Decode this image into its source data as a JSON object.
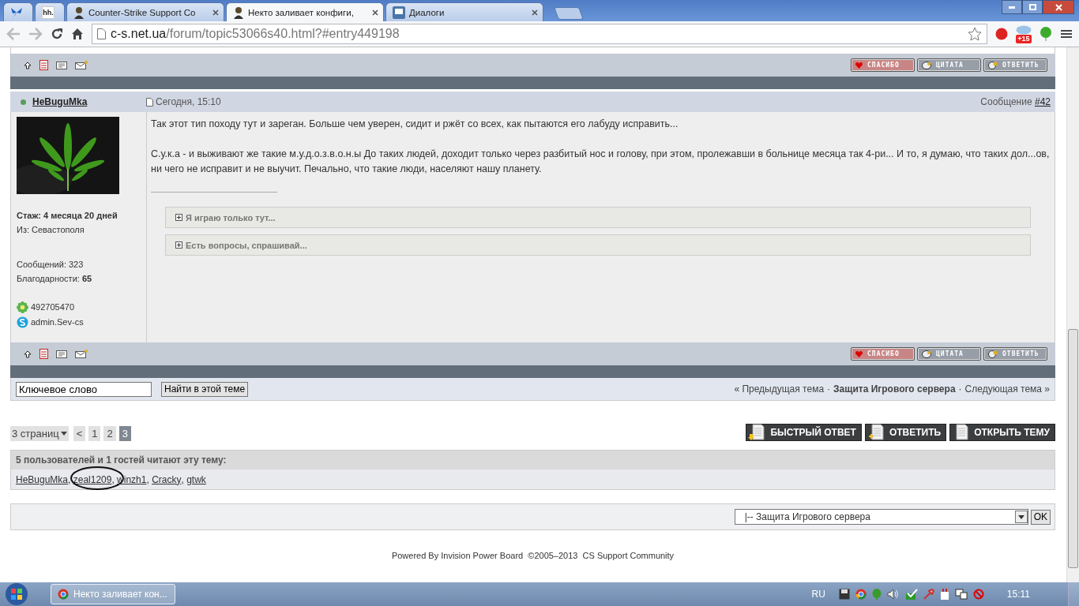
{
  "browser": {
    "tabs": [
      {
        "kind": "butterfly",
        "selected": false
      },
      {
        "kind": "hh",
        "icon_text": "hh.",
        "selected": false
      },
      {
        "kind": "person",
        "title": "Counter-Strike Support Co",
        "selected": false
      },
      {
        "kind": "person",
        "title": "Некто заливает конфиги,",
        "selected": true
      },
      {
        "kind": "chat",
        "title": "Диалоги",
        "selected": false
      }
    ],
    "address": {
      "host": "c-s.net.ua",
      "path": "/forum/topic53066s40.html?#entry449198"
    },
    "extension_badge": "+15"
  },
  "post": {
    "author": "HeBuguMka",
    "online": true,
    "date": "Сегодня, 15:10",
    "number_label": "Сообщение",
    "number": "#42",
    "paragraphs": [
      "Так этот тип походу тут и зареган. Больше чем уверен, сидит и ржёт со всех, как пытаются его лабуду исправить...",
      "С.у.к.а - и выживают же такие м.у.д.о.з.в.о.н.ы До таких людей, доходит только через разбитый нос и голову, при этом, пролежавши в больнице месяца так 4-ри... И то, я думаю, что таких дол...ов, ни чего не исправит и не выучит. Печально, что такие люди, населяют нашу планету."
    ],
    "spoilers": [
      {
        "label": "Я играю только тут...",
        "expanded": false
      },
      {
        "label": "Есть вопросы, спрашивай...",
        "expanded": false
      }
    ],
    "profile": {
      "stat_groups": [
        [
          {
            "text": "Стаж: 4 месяца 20 дней",
            "bold": true
          },
          {
            "text": "Из: Севастополя",
            "bold": false
          }
        ],
        [
          {
            "text": "Сообщений: 323",
            "bold": false
          },
          {
            "text": "Благодарности: **65**",
            "bold": false
          }
        ]
      ],
      "contacts": [
        {
          "kind": "icq",
          "text": "492705470"
        },
        {
          "kind": "skype",
          "text": "admin.Sev-cs"
        }
      ]
    }
  },
  "action_bars": [
    {
      "buttons": [
        {
          "kind": "thanks",
          "label": "СПАСИБО"
        },
        {
          "kind": "quote",
          "label": "ЦИТАТА"
        },
        {
          "kind": "reply",
          "label": "ОТВЕТИТЬ"
        }
      ]
    },
    {
      "buttons": [
        {
          "kind": "thanks",
          "label": "СПАСИБО"
        },
        {
          "kind": "quote",
          "label": "ЦИТАТА"
        },
        {
          "kind": "reply",
          "label": "ОТВЕТИТЬ"
        }
      ]
    }
  ],
  "topic_search": {
    "value": "Ключевое слово",
    "button": "Найти в этой теме"
  },
  "topic_nav": [
    {
      "kind": "link",
      "text": "« Предыдущая тема"
    },
    {
      "kind": "sep",
      "text": "·"
    },
    {
      "kind": "current",
      "text": "Защита Игрового сервера"
    },
    {
      "kind": "sep",
      "text": "·"
    },
    {
      "kind": "link",
      "text": "Следующая тема »"
    }
  ],
  "pagination": {
    "pages_menu": "3 страниц",
    "prev": "<",
    "pages": [
      {
        "label": "1",
        "selected": false
      },
      {
        "label": "2",
        "selected": false
      },
      {
        "label": "3",
        "selected": true
      }
    ]
  },
  "topic_buttons": [
    {
      "kind": "down",
      "label": "БЫСТРЫЙ ОТВЕТ"
    },
    {
      "kind": "plus",
      "label": "ОТВЕТИТЬ"
    },
    {
      "kind": "doc",
      "label": "ОТКРЫТЬ ТЕМУ"
    }
  ],
  "viewers": {
    "title": "5 пользователей и 1 гостей читают эту тему:",
    "users": [
      {
        "name": "HeBuguMka",
        "circled": false
      },
      {
        "name": "zeal1209",
        "circled": true
      },
      {
        "name": "winzh1",
        "circled": false
      },
      {
        "name": "Cracky",
        "circled": false
      },
      {
        "name": "gtwk",
        "circled": false
      }
    ],
    "separator": ", "
  },
  "forum_jump": {
    "value": "|-- Защита Игрового сервера",
    "button": "OK"
  },
  "footer": "Powered By Invision Power Board  ©2005–2013  CS Support Community",
  "taskbar": {
    "task": "Некто заливает кон...",
    "language": "RU",
    "time": "15:11"
  }
}
